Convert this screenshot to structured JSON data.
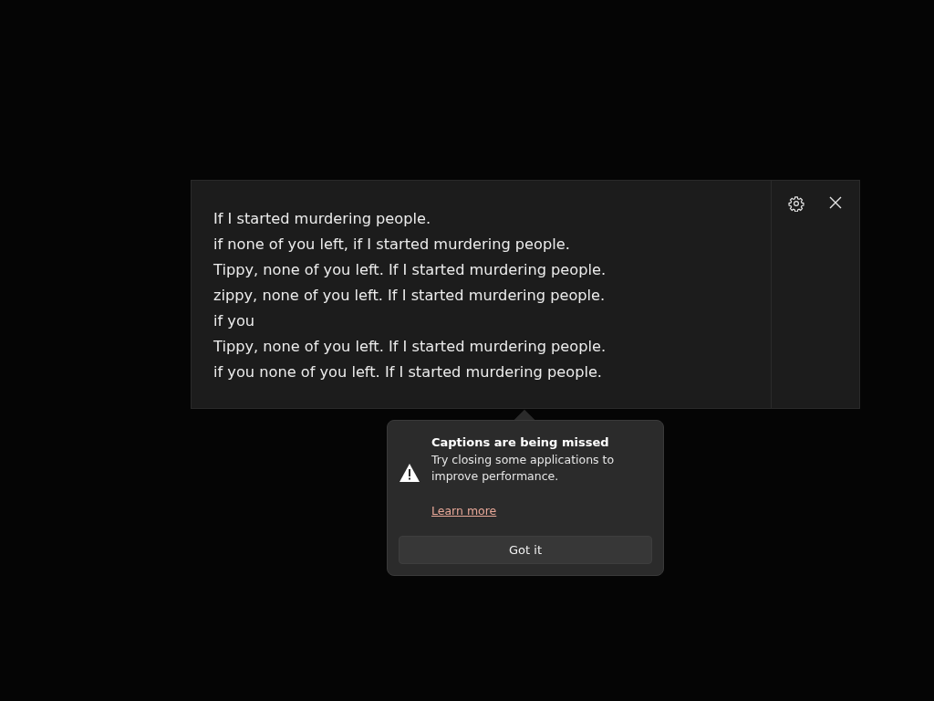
{
  "captions": {
    "lines": [
      "If I started murdering people.",
      "if none of you left, if I started murdering people.",
      "Tippy, none of you left. If I started murdering people.",
      "zippy, none of you left. If I started murdering people.",
      "if you",
      "Tippy, none of you left. If I started murdering people.",
      "if you none of you left. If I started murdering people."
    ]
  },
  "notice": {
    "title": "Captions are being missed",
    "message": "Try closing some applications to improve performance.",
    "link": "Learn more",
    "button": "Got it"
  }
}
